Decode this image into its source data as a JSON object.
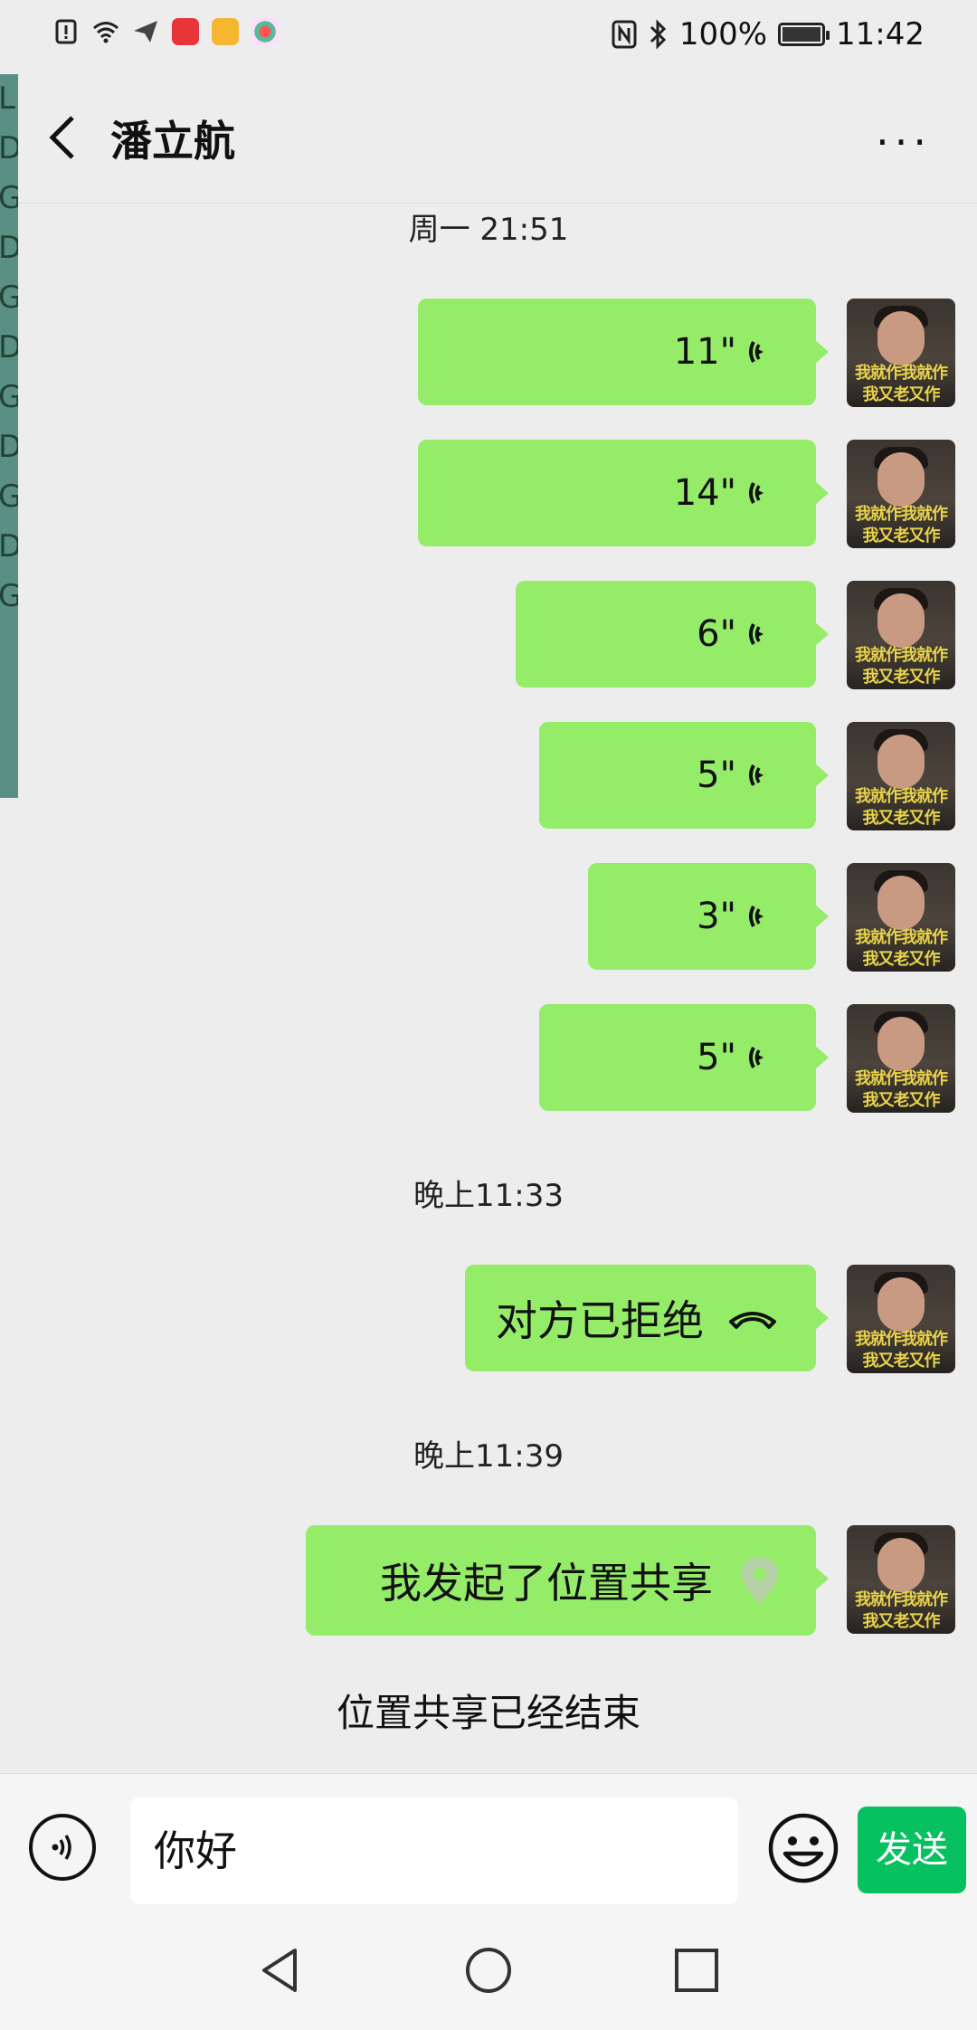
{
  "status_bar": {
    "battery": "100%",
    "time": "11:42",
    "battery_level": 1.0
  },
  "left_strip": {
    "letters": [
      "L",
      "D",
      "G",
      "D",
      "G",
      "D",
      "G",
      "D",
      "G",
      "D",
      "G"
    ]
  },
  "header": {
    "title": "潘立航",
    "more": "···"
  },
  "chat": {
    "time1": "周一 21:51",
    "voice_messages": [
      {
        "duration": "11\""
      },
      {
        "duration": "14\""
      },
      {
        "duration": "6\""
      },
      {
        "duration": "5\""
      },
      {
        "duration": "3\""
      },
      {
        "duration": "5\""
      }
    ],
    "time2": "晚上11:33",
    "call_message": "对方已拒绝",
    "time3": "晚上11:39",
    "location_message": "我发起了位置共享",
    "system_note": "位置共享已经结束",
    "avatar_caption_line1": "我就作我就作",
    "avatar_caption_line2": "我又老又作"
  },
  "input_bar": {
    "input_value": "你好",
    "send_label": "发送"
  },
  "colors": {
    "bubble": "#95ec69",
    "send": "#07c160",
    "background": "#ededed"
  }
}
